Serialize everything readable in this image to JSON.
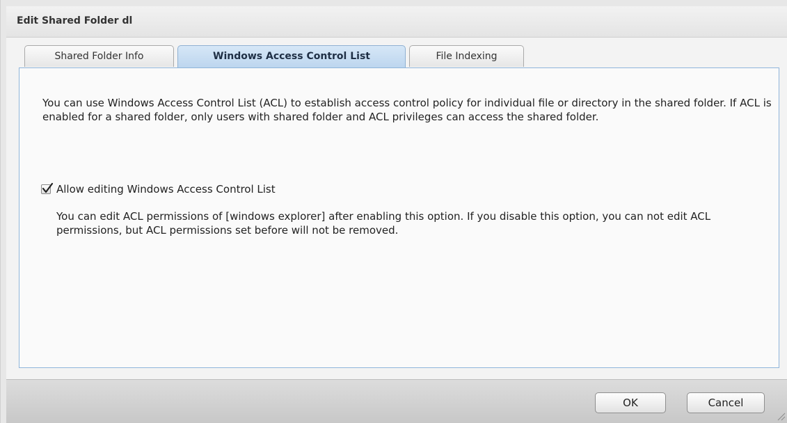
{
  "dialog": {
    "title": "Edit Shared Folder dl"
  },
  "tabs": [
    {
      "label": "Shared Folder Info",
      "active": false
    },
    {
      "label": "Windows Access Control List",
      "active": true
    },
    {
      "label": "File Indexing",
      "active": false
    }
  ],
  "panel": {
    "description": "You can use Windows Access Control List (ACL) to establish access control policy for individual file or directory in the shared folder. If ACL is enabled for a shared folder, only users with shared folder and ACL privileges can access the shared folder.",
    "checkbox_label": "Allow editing Windows Access Control List",
    "checkbox_checked": true,
    "hint": "You can edit ACL permissions of [windows explorer] after enabling this option. If you disable this option, you can not edit ACL permissions, but ACL permissions set before will not be removed."
  },
  "footer": {
    "ok_label": "OK",
    "cancel_label": "Cancel"
  },
  "colors": {
    "active_tab": "#c4dbf1",
    "panel_border": "#8fb5db"
  },
  "icons": {
    "checkbox": "checkmark-icon",
    "resize": "resize-grip-icon"
  }
}
